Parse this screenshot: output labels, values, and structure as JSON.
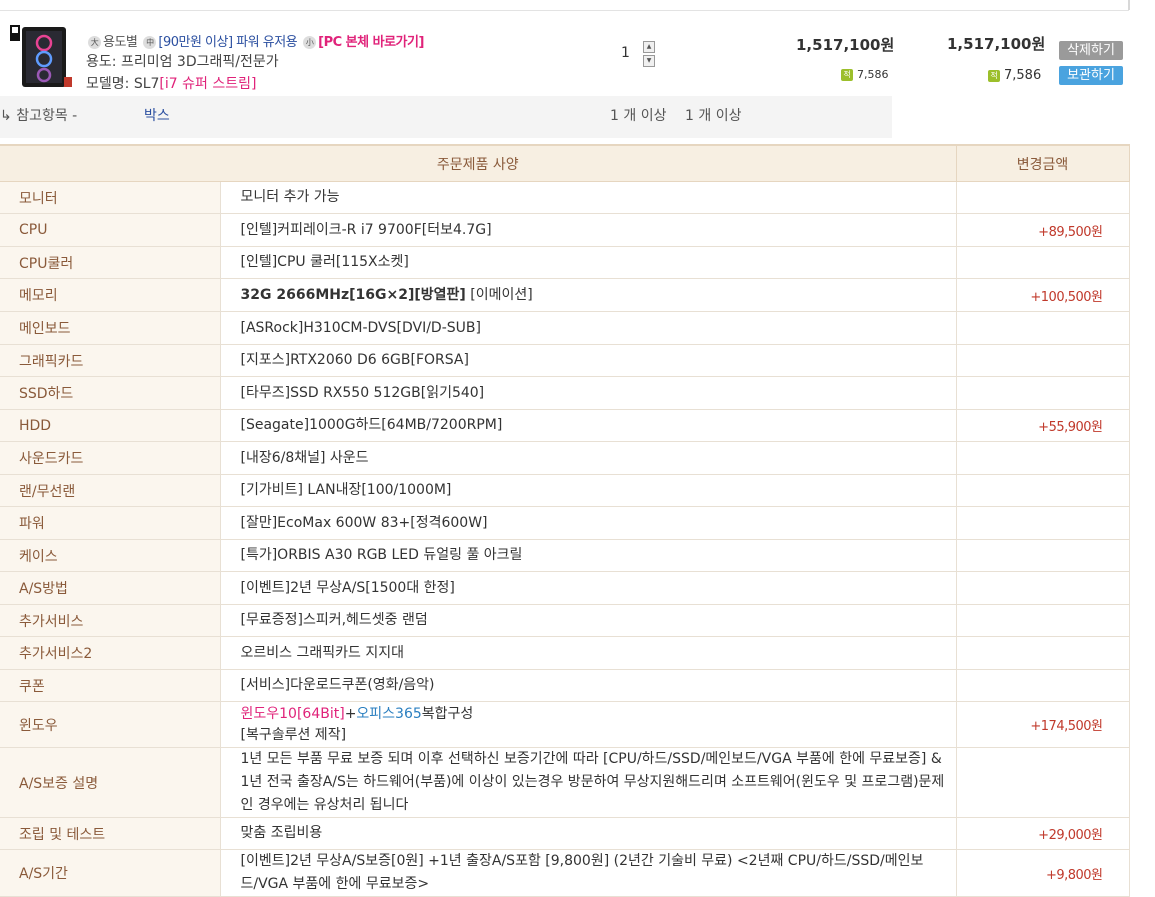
{
  "product": {
    "badges": [
      {
        "icon": "大",
        "text": "용도별"
      },
      {
        "icon": "中",
        "text": "[90만원 이상] 파워 유저용"
      },
      {
        "icon": "小",
        "text": ""
      }
    ],
    "direct_link": "[PC 본체 바로가기]",
    "use_label": "용도:",
    "use_value": "프리미엄 3D그래픽/전문가",
    "model_label": "모델명:",
    "model_code": "SL7",
    "model_name": "[i7 슈퍼 스트림]",
    "quantity": "1",
    "unit_price": "1,517,100원",
    "unit_points": "7,586",
    "total_price": "1,517,100원",
    "total_points": "7,586",
    "points_icon": "적",
    "delete_label": "삭제하기",
    "keep_label": "보관하기"
  },
  "reference": {
    "label": "참고항목 -",
    "value": "박스",
    "min1": "1 개 이상",
    "min2": "1 개 이상"
  },
  "spec_table": {
    "header_spec": "주문제품 사양",
    "header_amount": "변경금액",
    "rows": [
      {
        "label": "모니터",
        "value": "모니터 추가 가능",
        "amount": ""
      },
      {
        "label": "CPU",
        "value": "[인텔]커피레이크-R i7 9700F[터보4.7G]",
        "amount": "+89,500원"
      },
      {
        "label": "CPU쿨러",
        "value": "[인텔]CPU 쿨러[115X소켓]",
        "amount": ""
      },
      {
        "label": "메모리",
        "value_bold": "32G 2666MHz[16G×2][방열판]",
        "value_rest": " [이메이션]",
        "amount": "+100,500원"
      },
      {
        "label": "메인보드",
        "value": "[ASRock]H310CM-DVS[DVI/D-SUB]",
        "amount": ""
      },
      {
        "label": "그래픽카드",
        "value": "[지포스]RTX2060 D6 6GB[FORSA]",
        "amount": ""
      },
      {
        "label": "SSD하드",
        "value": "[타무즈]SSD RX550 512GB[읽기540]",
        "amount": ""
      },
      {
        "label": "HDD",
        "value": "[Seagate]1000G하드[64MB/7200RPM]",
        "amount": "+55,900원"
      },
      {
        "label": "사운드카드",
        "value": "[내장6/8채널] 사운드",
        "amount": ""
      },
      {
        "label": "랜/무선랜",
        "value": "[기가비트] LAN내장[100/1000M]",
        "amount": ""
      },
      {
        "label": "파워",
        "value": "[잘만]EcoMax 600W 83+[정격600W]",
        "amount": ""
      },
      {
        "label": "케이스",
        "value": "[특가]ORBIS A30 RGB LED 듀얼링 풀 아크릴",
        "amount": ""
      },
      {
        "label": "A/S방법",
        "value": "[이벤트]2년 무상A/S[1500대 한정]",
        "amount": ""
      },
      {
        "label": "추가서비스",
        "value": "[무료증정]스피커,헤드셋중 랜덤",
        "amount": ""
      },
      {
        "label": "추가서비스2",
        "value": "오르비스 그래픽카드 지지대",
        "amount": ""
      },
      {
        "label": "쿠폰",
        "value": "[서비스]다운로드쿠폰(영화/음악)",
        "amount": ""
      },
      {
        "label": "윈도우",
        "win_a": "윈도우10[64Bit]",
        "win_plus": "+",
        "win_b": "오피스365",
        "win_c": "복합구성",
        "win_d": "[복구솔루션 제작]",
        "amount": "+174,500원"
      },
      {
        "label": "A/S보증 설명",
        "value": "1년 모든 부품 무료 보증 되며 이후 선택하신 보증기간에 따라 [CPU/하드/SSD/메인보드/VGA 부품에 한에 무료보증] & 1년 전국 출장A/S는 하드웨어(부품)에 이상이 있는경우 방문하여 무상지원해드리며 소프트웨어(윈도우 및 프로그램)문제인 경우에는 유상처리 됩니다",
        "amount": ""
      },
      {
        "label": "조립 및 테스트",
        "value": "맞춤 조립비용",
        "amount": "+29,000원"
      },
      {
        "label": "A/S기간",
        "value": "[이벤트]2년 무상A/S보증[0원] +1년 출장A/S포함 [9,800원] (2년간 기술비 무료) <2년째 CPU/하드/SSD/메인보드/VGA 부품에 한에 무료보증>",
        "amount": "+9,800원"
      }
    ]
  }
}
